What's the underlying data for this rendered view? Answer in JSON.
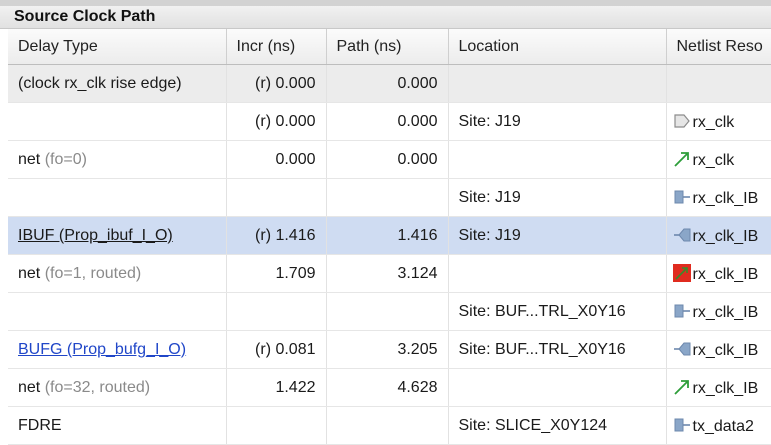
{
  "section": {
    "title": "Source Clock Path"
  },
  "columns": [
    "Delay Type",
    "Incr (ns)",
    "Path (ns)",
    "Location",
    "Netlist Reso"
  ],
  "rows": [
    {
      "delay_type": "(clock rx_clk rise edge)",
      "delay_note": "",
      "delay_style": "plain",
      "incr": "(r) 0.000",
      "path": "0.000",
      "location": "",
      "netlist": "",
      "icon": "",
      "state": "shaded"
    },
    {
      "delay_type": "",
      "delay_note": "",
      "delay_style": "plain",
      "incr": "(r) 0.000",
      "path": "0.000",
      "location": "Site: J19",
      "netlist": "rx_clk",
      "icon": "port-icon",
      "state": "normal"
    },
    {
      "delay_type": "net",
      "delay_note": " (fo=0)",
      "delay_style": "plain",
      "incr": "0.000",
      "path": "0.000",
      "location": "",
      "netlist": "rx_clk",
      "icon": "net-arrow-icon",
      "state": "normal"
    },
    {
      "delay_type": "",
      "delay_note": "",
      "delay_style": "plain",
      "incr": "",
      "path": "",
      "location": "Site: J19",
      "netlist": "rx_clk_IB",
      "icon": "pin-out-icon",
      "state": "normal"
    },
    {
      "delay_type": "IBUF (Prop_ibuf_I_O)",
      "delay_note": "",
      "delay_style": "underline",
      "incr": "(r) 1.416",
      "path": "1.416",
      "location": "Site: J19",
      "netlist": "rx_clk_IB",
      "icon": "pin-in-icon",
      "state": "selected"
    },
    {
      "delay_type": "net",
      "delay_note": " (fo=1, routed)",
      "delay_style": "plain",
      "incr": "1.709",
      "path": "3.124",
      "location": "",
      "netlist": "rx_clk_IB",
      "icon": "net-routed-icon",
      "state": "normal"
    },
    {
      "delay_type": "",
      "delay_note": "",
      "delay_style": "plain",
      "incr": "",
      "path": "",
      "location": "Site: BUF...TRL_X0Y16",
      "netlist": "rx_clk_IB",
      "icon": "pin-out-icon",
      "state": "normal"
    },
    {
      "delay_type": "BUFG (Prop_bufg_I_O)",
      "delay_note": "",
      "delay_style": "link",
      "incr": "(r) 0.081",
      "path": "3.205",
      "location": "Site: BUF...TRL_X0Y16",
      "netlist": "rx_clk_IB",
      "icon": "pin-in-icon",
      "state": "normal"
    },
    {
      "delay_type": "net",
      "delay_note": " (fo=32, routed)",
      "delay_style": "plain",
      "incr": "1.422",
      "path": "4.628",
      "location": "",
      "netlist": "rx_clk_IB",
      "icon": "net-arrow-icon",
      "state": "normal"
    },
    {
      "delay_type": "FDRE",
      "delay_note": "",
      "delay_style": "plain",
      "incr": "",
      "path": "",
      "location": "Site: SLICE_X0Y124",
      "netlist": "tx_data2",
      "icon": "pin-out-icon",
      "state": "normal"
    }
  ],
  "colors": {
    "selected_row": "#cfdcf2",
    "link": "#2046c8",
    "net_arrow": "#2e9e3a",
    "net_routed": "#e02b1f"
  }
}
